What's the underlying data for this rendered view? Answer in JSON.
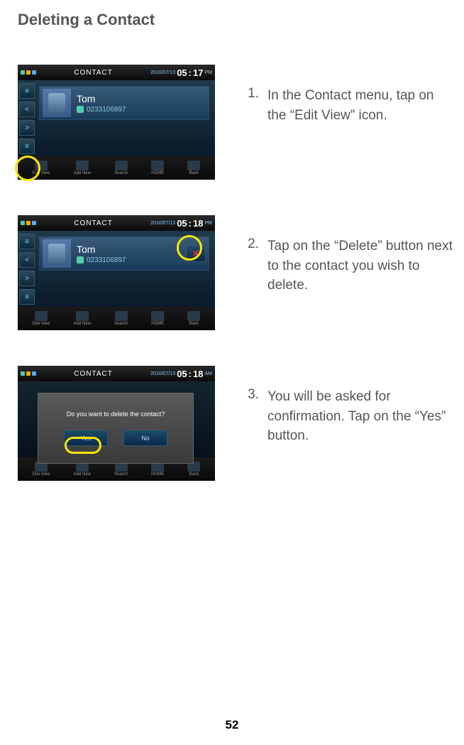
{
  "title": "Deleting a Contact",
  "pageNumber": "52",
  "header": {
    "title": "CONTACT",
    "date": "2010/07/13",
    "hour": "05",
    "colon": ":",
    "pm": "PM"
  },
  "times": {
    "t1": "17",
    "t2": "18",
    "t3": "18",
    "am3": "AM"
  },
  "contact": {
    "name": "Tom",
    "number": "0233106897"
  },
  "footer": {
    "editView": "Edit View",
    "dialView": "Dial View",
    "addNew": "Add New",
    "search": "Search",
    "home": "HOME",
    "back": "Back"
  },
  "dialog": {
    "text": "Do you want to delete the contact?",
    "yes": "Yes",
    "no": "No"
  },
  "steps": [
    {
      "num": "1.",
      "text": "In the Contact menu, tap on the “Edit View” icon."
    },
    {
      "num": "2.",
      "text": "Tap on the “Delete” button next to the contact you wish to delete."
    },
    {
      "num": "3.",
      "text": "You will be asked for confirmation. Tap on the “Yes” button."
    }
  ]
}
